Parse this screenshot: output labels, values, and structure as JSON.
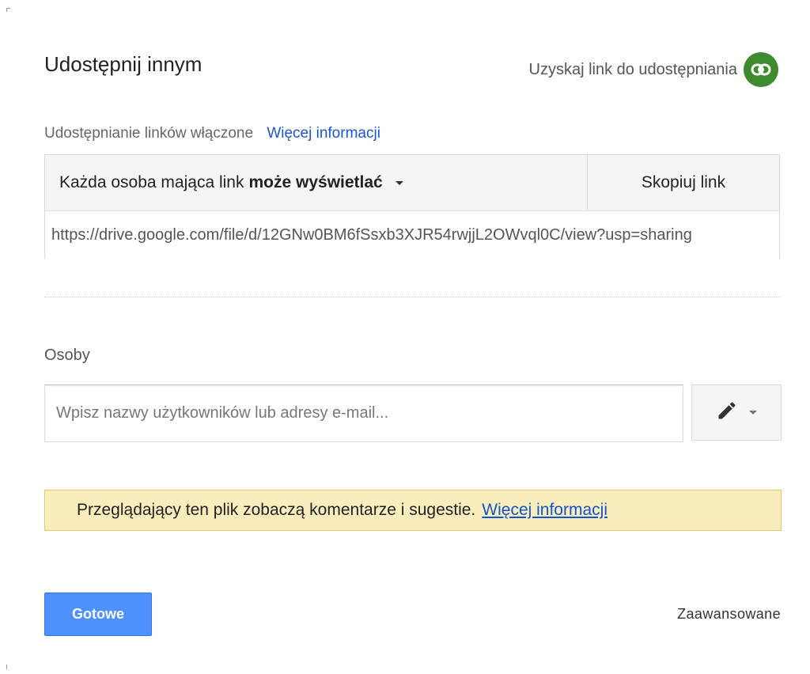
{
  "dialog": {
    "title": "Udostępnij innym",
    "get_link_label": "Uzyskaj link do udostępniania"
  },
  "link_sharing": {
    "status_text": "Udostępnianie linków włączone",
    "more_info": "Więcej informacji",
    "permission_prefix": "Każda osoba mająca link",
    "permission_value": "może wyświetlać",
    "copy_link_label": "Skopiuj link",
    "url": "https://drive.google.com/file/d/12GNw0BM6fSsxb3XJR54rwjjL2OWvql0C/view?usp=sharing"
  },
  "people": {
    "label": "Osoby",
    "input_placeholder": "Wpisz nazwy użytkowników lub adresy e-mail..."
  },
  "notice": {
    "text": "Przeglądający ten plik zobaczą komentarze i sugestie.",
    "link": "Więcej informacji"
  },
  "footer": {
    "done_label": "Gotowe",
    "advanced_label": "Zaawansowane"
  },
  "colors": {
    "accent_blue": "#4d90fe",
    "link_icon_green": "#3d8b2e",
    "notice_bg": "#f9edbe",
    "link_color": "#1a56d6"
  },
  "icons": {
    "get_link": "link-icon",
    "permission_dropdown": "caret-down-icon",
    "edit_permission": "pencil-icon"
  }
}
